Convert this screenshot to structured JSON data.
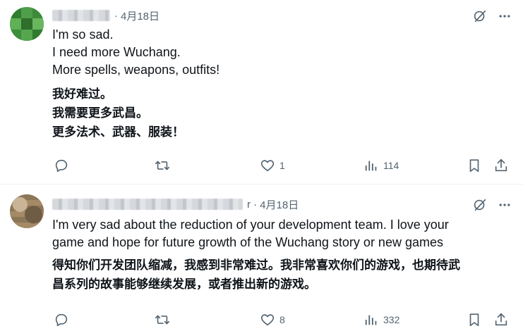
{
  "posts": [
    {
      "date": "4月18日",
      "separator": "·",
      "text_en": [
        "I'm so sad.",
        "I need more Wuchang.",
        "More spells, weapons, outfits!"
      ],
      "text_zh": [
        "我好难过。",
        "我需要更多武昌。",
        "更多法术、武器、服装！"
      ],
      "stats": {
        "likes": "1",
        "views": "114"
      }
    },
    {
      "date": "4月18日",
      "separator": "r ·",
      "text_en": [
        "I'm very sad about the reduction of your development team. I love your",
        "game and hope for future growth of the Wuchang story or new games"
      ],
      "text_zh": [
        "得知你们开发团队缩减，我感到非常难过。我非常喜欢你们的游戏，也期待武",
        "昌系列的故事能够继续发展，或者推出新的游戏。"
      ],
      "stats": {
        "likes": "8",
        "views": "332"
      }
    }
  ],
  "icons": {
    "grok": "grok-icon",
    "more": "more-icon",
    "reply": "reply-icon",
    "repost": "repost-icon",
    "like": "heart-icon",
    "views": "views-icon",
    "bookmark": "bookmark-icon",
    "share": "share-icon"
  },
  "colors": {
    "text": "#0f1419",
    "secondary": "#536471",
    "divider": "#eff3f4"
  }
}
